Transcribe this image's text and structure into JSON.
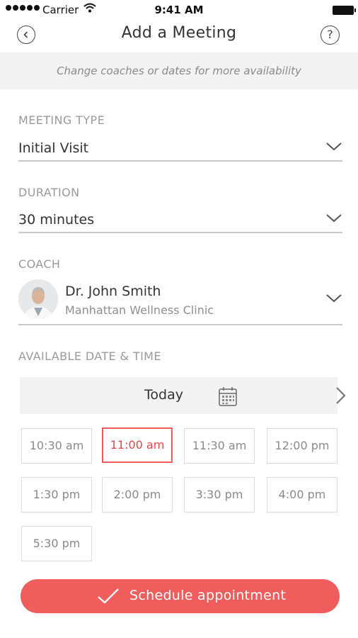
{
  "status_bar": {
    "carrier": "Carrier",
    "time": "9:41 AM"
  },
  "nav": {
    "title": "Add a Meeting",
    "back_icon": "chevron-left-icon",
    "help_symbol": "?"
  },
  "banner": {
    "text": "Change coaches or dates for more availability"
  },
  "meeting_type": {
    "label": "MEETING TYPE",
    "value": "Initial Visit"
  },
  "duration": {
    "label": "DURATION",
    "value": "30 minutes"
  },
  "coach": {
    "label": "COACH",
    "name": "Dr. John Smith",
    "clinic": "Manhattan Wellness Clinic"
  },
  "availability": {
    "label": "AVAILABLE DATE & TIME",
    "date": "Today",
    "slots": [
      "10:30 am",
      "11:00 am",
      "11:30 am",
      "12:00 pm",
      "1:30 pm",
      "2:00 pm",
      "3:30 pm",
      "4:00 pm",
      "5:30 pm"
    ],
    "selected_slot": "11:00 am"
  },
  "cta": {
    "label": "Schedule appointment"
  },
  "colors": {
    "accent": "#ef5d5d",
    "selected_border": "#ec5b5b",
    "banner_bg": "#f3f3f3"
  }
}
